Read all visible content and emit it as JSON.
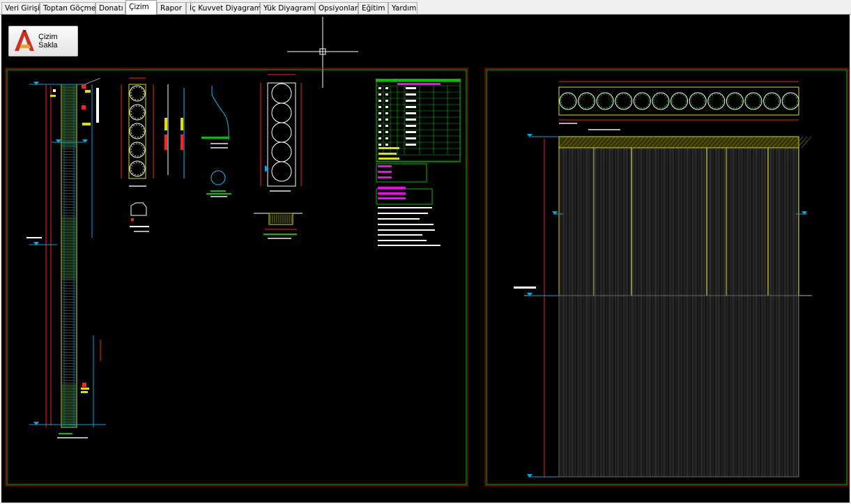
{
  "tabs": [
    {
      "label": "Veri Girişi",
      "active": false
    },
    {
      "label": "Toptan Göçme",
      "active": false
    },
    {
      "label": "Donatı",
      "active": false
    },
    {
      "label": "Çizim",
      "active": true
    },
    {
      "label": "Rapor",
      "active": false
    },
    {
      "label": "İç Kuvvet Diyagramı",
      "active": false
    },
    {
      "label": "Yük Diyagramı",
      "active": false
    },
    {
      "label": "Opsiyonlar",
      "active": false
    },
    {
      "label": "Eğitim",
      "active": false
    },
    {
      "label": "Yardım",
      "active": false
    }
  ],
  "toolbar": {
    "save_label": "Çizim Sakla",
    "save_icon": "autocad-icon"
  },
  "colors": {
    "canvas": "#000000",
    "frame_green": "#00c000",
    "frame_red": "#d00000",
    "drawing_yellow": "#e0e000",
    "dim_red": "#ff2020",
    "cyan": "#00c8ff",
    "magenta": "#ff00ff",
    "text_white": "#ffffff"
  }
}
